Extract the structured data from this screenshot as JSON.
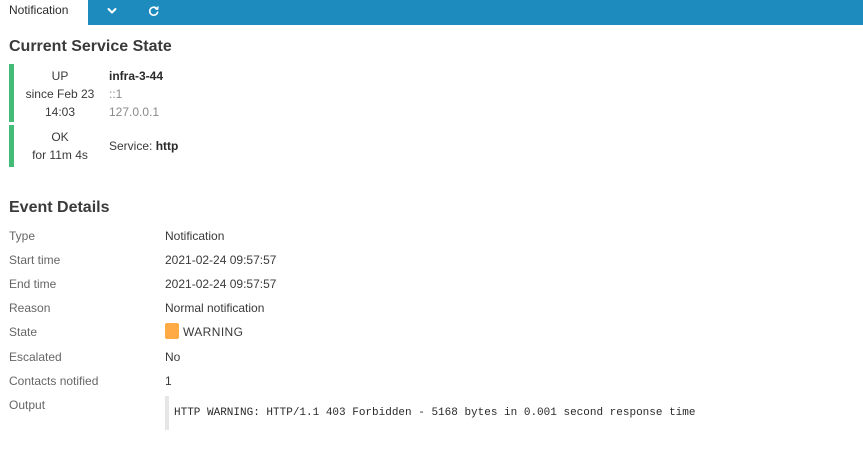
{
  "tabs": {
    "active_label": "Notification",
    "dropdown_icon": "chevron-down-icon",
    "refresh_icon": "refresh-icon"
  },
  "service_state": {
    "title": "Current Service State",
    "host": {
      "state": "UP",
      "since_line1": "since Feb 23",
      "since_line2": "14:03",
      "name": "infra-3-44",
      "address6": "::1",
      "address4": "127.0.0.1"
    },
    "service": {
      "state": "OK",
      "duration": "for 11m 4s",
      "prefix": "Service:",
      "name": "http"
    }
  },
  "event_details": {
    "title": "Event Details",
    "rows": [
      {
        "label": "Type",
        "value": "Notification"
      },
      {
        "label": "Start time",
        "value": "2021-02-24 09:57:57"
      },
      {
        "label": "End time",
        "value": "2021-02-24 09:57:57"
      },
      {
        "label": "Reason",
        "value": "Normal notification"
      },
      {
        "label": "State",
        "value": "WARNING"
      },
      {
        "label": "Escalated",
        "value": "No"
      },
      {
        "label": "Contacts notified",
        "value": "1"
      },
      {
        "label": "Output",
        "value": "HTTP WARNING: HTTP/1.1 403 Forbidden - 5168 bytes in 0.001 second response time"
      }
    ]
  },
  "colors": {
    "tabbar": "#1d8bbd",
    "state_ok": "#44bb77",
    "state_warning": "#ffaa44"
  }
}
